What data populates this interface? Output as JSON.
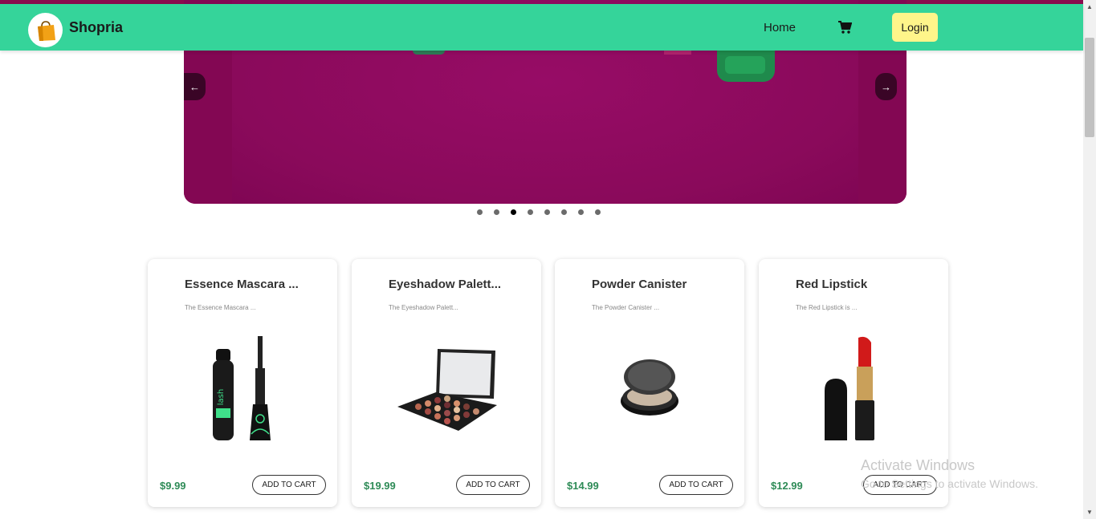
{
  "navbar": {
    "brand": "Shopria",
    "home_label": "Home",
    "login_label": "Login",
    "icons": [
      "shopping-bag-icon",
      "cart-icon"
    ],
    "bg_color": "#35d49a"
  },
  "carousel": {
    "prev_label": "←",
    "next_label": "→",
    "dot_count": 8,
    "active_dot": 3,
    "bg_color": "#8c0a5c"
  },
  "products": [
    {
      "title": "Essence Mascara ...",
      "desc": "The Essence Mascara ...",
      "price": "$9.99",
      "button": "ADD TO CART",
      "image": "mascara"
    },
    {
      "title": "Eyeshadow Palett...",
      "desc": "The Eyeshadow Palett...",
      "price": "$19.99",
      "button": "ADD TO CART",
      "image": "eyeshadow-palette"
    },
    {
      "title": "Powder Canister",
      "desc": "The Powder Canister ...",
      "price": "$14.99",
      "button": "ADD TO CART",
      "image": "powder-canister"
    },
    {
      "title": "Red Lipstick",
      "desc": "The Red Lipstick is ...",
      "price": "$12.99",
      "button": "ADD TO CART",
      "image": "red-lipstick"
    }
  ],
  "watermark": {
    "line1": "Activate Windows",
    "line2": "Go to Settings to activate Windows."
  },
  "colors": {
    "price": "#2e8b57",
    "login_bg": "#fff58a"
  }
}
